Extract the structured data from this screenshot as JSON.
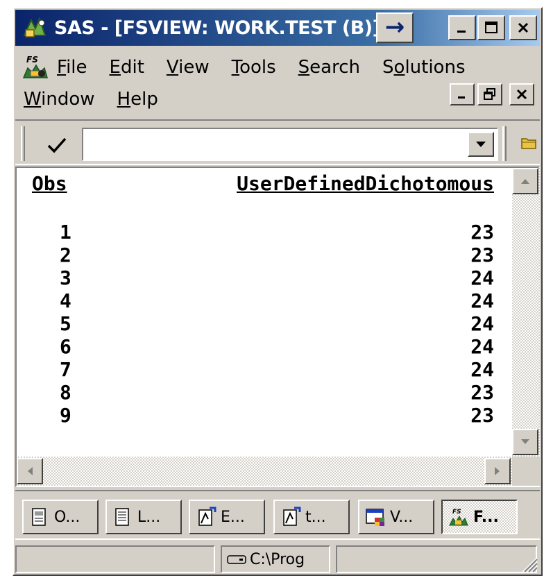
{
  "window": {
    "title": "SAS - [FSVIEW:  WORK.TEST (B)]",
    "arrow_button": "→"
  },
  "menu": {
    "row1": [
      "File",
      "Edit",
      "View",
      "Tools",
      "Search",
      "Solutions"
    ],
    "row2": [
      "Window",
      "Help"
    ]
  },
  "command_bar": {
    "check_label": "✓",
    "command_value": ""
  },
  "table": {
    "columns": [
      "Obs",
      "UserDefinedDichotomous"
    ],
    "rows": [
      {
        "obs": "1",
        "value": "23"
      },
      {
        "obs": "2",
        "value": "23"
      },
      {
        "obs": "3",
        "value": "24"
      },
      {
        "obs": "4",
        "value": "24"
      },
      {
        "obs": "5",
        "value": "24"
      },
      {
        "obs": "6",
        "value": "24"
      },
      {
        "obs": "7",
        "value": "24"
      },
      {
        "obs": "8",
        "value": "23"
      },
      {
        "obs": "9",
        "value": "23"
      }
    ]
  },
  "taskbar": {
    "items": [
      {
        "label": "O...",
        "icon": "output-icon"
      },
      {
        "label": "L...",
        "icon": "log-icon"
      },
      {
        "label": "E...",
        "icon": "editor-icon"
      },
      {
        "label": "t...",
        "icon": "editor-icon"
      },
      {
        "label": "V...",
        "icon": "viewtable-icon"
      },
      {
        "label": "F...",
        "icon": "fsview-icon",
        "active": true
      }
    ]
  },
  "status": {
    "path": "C:\\Prog"
  },
  "colors": {
    "title_gradient_start": "#0a246a",
    "title_gradient_end": "#a6caf0",
    "face": "#d4d0c8"
  }
}
